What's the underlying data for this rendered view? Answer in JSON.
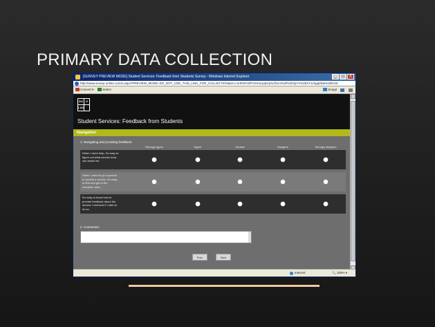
{
  "slide": {
    "title": "PRIMARY DATA COLLECTION"
  },
  "window": {
    "title": "[SURVEY PREVIEW MODE] Student Services: Feedback from Students Survey - Windows Internet Explorer",
    "url": "http://www.survey-online.com/s.aspx?PREVIEW_MODE=DO_NOT_USE_THIS_LINK_FOR_COLLECTION&sm=mrRz6%2fFcKtHcqUjt1Q%2fUz4%2f%2fJQYV%2bXYJvhgq0Dw%3d%3d",
    "minimize_label": "_",
    "maximize_label": "□",
    "close_label": "X",
    "toolbar": {
      "convert_label": "Convert",
      "select_label": "Select",
      "snagit_label": "Snagit"
    },
    "status": {
      "zone_label": "Internet",
      "zoom_label": "100%"
    }
  },
  "page": {
    "logo_letters": [
      "DO",
      "U",
      "LAS",
      ""
    ],
    "site_title": "Student Services: Feedback from Students",
    "nav_label": "Navigation",
    "question1": "1. Navigating and providing feedback:",
    "scale": [
      "Strongly agree",
      "Agree",
      "Neutral",
      "Disagree",
      "Strongly disagree"
    ],
    "statements": [
      "When I need help, it's easy to figure out what service area can assist me.",
      "When I need to go in person to access a service, it's easy to find and get to the reception area.",
      "It's easy to know how to provide feedback about the service I received if I wish to do so."
    ],
    "question2": "2. Comments:",
    "prev_label": "Prev",
    "next_label": "Next"
  },
  "colors": {
    "nav_bar": "#b1ba1a",
    "header": "#111111",
    "slide_accent": "#e8b98a"
  }
}
